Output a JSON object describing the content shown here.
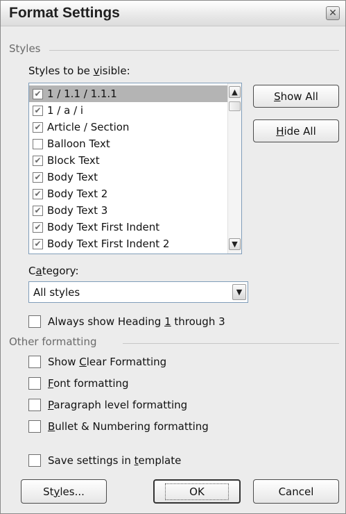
{
  "dialog": {
    "title": "Format Settings",
    "close_glyph": "✕"
  },
  "styles_group": {
    "title": "Styles",
    "visible_label_pre": "Styles to be ",
    "visible_label_key": "v",
    "visible_label_post": "isible:",
    "items": [
      {
        "label": "1 / 1.1 / 1.1.1",
        "checked": true,
        "selected": true
      },
      {
        "label": "1 / a / i",
        "checked": true,
        "selected": false
      },
      {
        "label": "Article / Section",
        "checked": true,
        "selected": false
      },
      {
        "label": "Balloon Text",
        "checked": false,
        "selected": false
      },
      {
        "label": "Block Text",
        "checked": true,
        "selected": false
      },
      {
        "label": "Body Text",
        "checked": true,
        "selected": false
      },
      {
        "label": "Body Text 2",
        "checked": true,
        "selected": false
      },
      {
        "label": "Body Text 3",
        "checked": true,
        "selected": false
      },
      {
        "label": "Body Text First Indent",
        "checked": true,
        "selected": false
      },
      {
        "label": "Body Text First Indent 2",
        "checked": true,
        "selected": false
      }
    ],
    "show_all_key": "S",
    "show_all_rest": "how All",
    "hide_all_key": "H",
    "hide_all_rest": "ide All",
    "category_label_pre": "C",
    "category_label_key": "a",
    "category_label_post": "tegory:",
    "category_value": "All styles",
    "always_show_pre": "Always show Heading ",
    "always_show_key": "1",
    "always_show_post": " through 3"
  },
  "other_group": {
    "title": "Other formatting",
    "options": [
      {
        "pre": "Show ",
        "key": "C",
        "post": "lear Formatting",
        "checked": false
      },
      {
        "pre": "",
        "key": "F",
        "post": "ont formatting",
        "checked": false
      },
      {
        "pre": "",
        "key": "P",
        "post": "aragraph level formatting",
        "checked": false
      },
      {
        "pre": "",
        "key": "B",
        "post": "ullet & Numbering formatting",
        "checked": false
      }
    ]
  },
  "save_template": {
    "pre": "Save settings in ",
    "key": "t",
    "post": "emplate",
    "checked": false
  },
  "footer": {
    "styles_pre": "St",
    "styles_key": "y",
    "styles_post": "les...",
    "ok_label": "OK",
    "cancel_label": "Cancel"
  },
  "icons": {
    "scroll_up": "▲",
    "scroll_down": "▼",
    "dropdown": "▼",
    "check": "✔"
  }
}
